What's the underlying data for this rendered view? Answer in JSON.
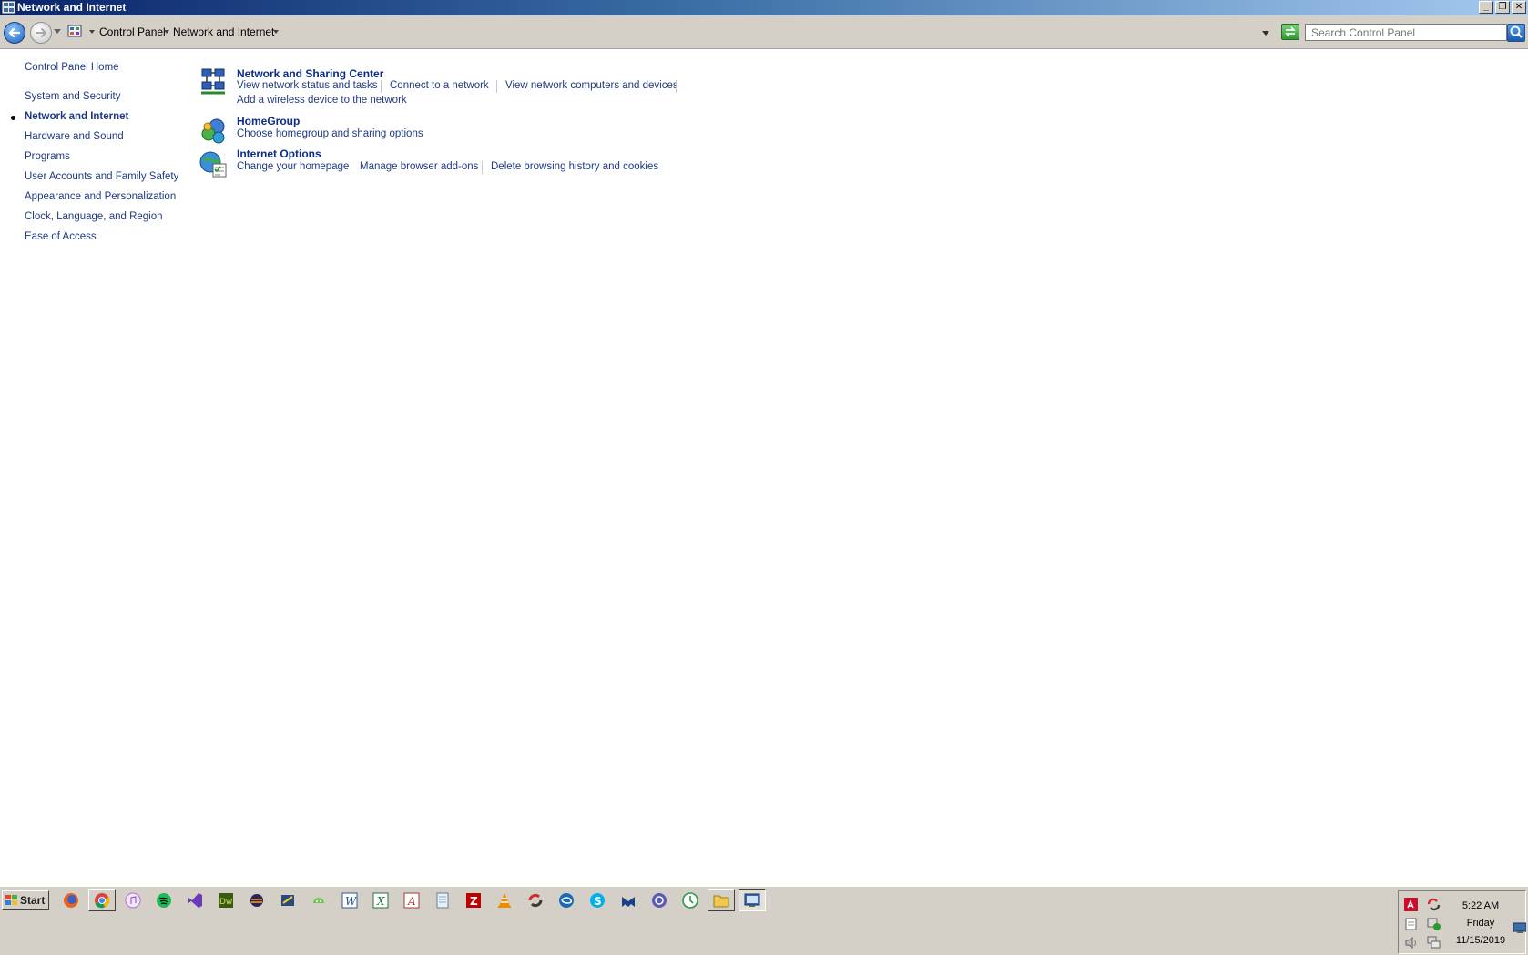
{
  "window": {
    "title": "Network and Internet"
  },
  "address_bar": {
    "breadcrumbs": [
      "Control Panel",
      "Network and Internet"
    ],
    "search_placeholder": "Search Control Panel"
  },
  "sidebar": {
    "home_label": "Control Panel Home",
    "items": [
      {
        "label": "System and Security",
        "current": false
      },
      {
        "label": "Network and Internet",
        "current": true
      },
      {
        "label": "Hardware and Sound",
        "current": false
      },
      {
        "label": "Programs",
        "current": false
      },
      {
        "label": "User Accounts and Family Safety",
        "current": false
      },
      {
        "label": "Appearance and Personalization",
        "current": false
      },
      {
        "label": "Clock, Language, and Region",
        "current": false
      },
      {
        "label": "Ease of Access",
        "current": false
      }
    ]
  },
  "categories": [
    {
      "title": "Network and Sharing Center",
      "icon": "network-sharing-icon",
      "tasks": [
        "View network status and tasks",
        "Connect to a network",
        "View network computers and devices",
        "Add a wireless device to the network"
      ]
    },
    {
      "title": "HomeGroup",
      "icon": "homegroup-icon",
      "tasks": [
        "Choose homegroup and sharing options"
      ]
    },
    {
      "title": "Internet Options",
      "icon": "internet-options-icon",
      "tasks": [
        "Change your homepage",
        "Manage browser add-ons",
        "Delete browsing history and cookies"
      ]
    }
  ],
  "taskbar": {
    "start_label": "Start",
    "apps": [
      "firefox-icon",
      "chrome-icon",
      "itunes-icon",
      "spotify-icon",
      "visual-studio-icon",
      "dreamweaver-icon",
      "eclipse-icon",
      "python-editor-icon",
      "android-studio-icon",
      "word-icon",
      "excel-icon",
      "access-icon",
      "notepad-icon",
      "filezilla-icon",
      "vlc-icon",
      "sync-icon",
      "swirl-app-icon",
      "skype-icon",
      "malwarebytes-icon",
      "browser-app-icon",
      "clock-app-icon",
      "file-explorer-icon",
      "control-panel-icon"
    ],
    "active_app": "control-panel-icon",
    "clock": {
      "time": "5:22 AM",
      "day": "Friday",
      "date": "11/15/2019"
    },
    "tray_icons": [
      "antivirus-icon",
      "sync-tray-icon",
      "clipboard-tray-icon",
      "security-tray-icon",
      "volume-icon",
      "network-tray-icon",
      "show-desktop-icon"
    ]
  },
  "colors": {
    "link": "#1e3a84",
    "heading_link": "#0b2c8a",
    "chrome_gray": "#d4d0c8",
    "title_gradient_start": "#0a246a"
  }
}
